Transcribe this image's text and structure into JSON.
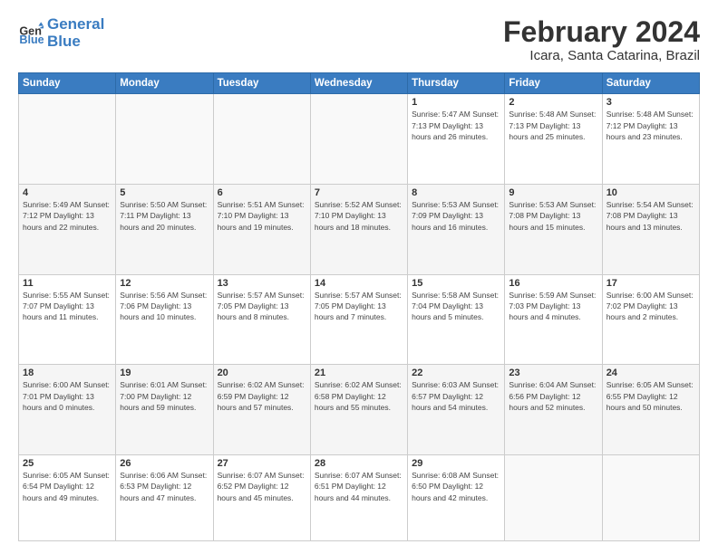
{
  "logo": {
    "line1": "General",
    "line2": "Blue"
  },
  "header": {
    "month_year": "February 2024",
    "location": "Icara, Santa Catarina, Brazil"
  },
  "days_of_week": [
    "Sunday",
    "Monday",
    "Tuesday",
    "Wednesday",
    "Thursday",
    "Friday",
    "Saturday"
  ],
  "weeks": [
    [
      {
        "day": "",
        "info": ""
      },
      {
        "day": "",
        "info": ""
      },
      {
        "day": "",
        "info": ""
      },
      {
        "day": "",
        "info": ""
      },
      {
        "day": "1",
        "info": "Sunrise: 5:47 AM\nSunset: 7:13 PM\nDaylight: 13 hours\nand 26 minutes."
      },
      {
        "day": "2",
        "info": "Sunrise: 5:48 AM\nSunset: 7:13 PM\nDaylight: 13 hours\nand 25 minutes."
      },
      {
        "day": "3",
        "info": "Sunrise: 5:48 AM\nSunset: 7:12 PM\nDaylight: 13 hours\nand 23 minutes."
      }
    ],
    [
      {
        "day": "4",
        "info": "Sunrise: 5:49 AM\nSunset: 7:12 PM\nDaylight: 13 hours\nand 22 minutes."
      },
      {
        "day": "5",
        "info": "Sunrise: 5:50 AM\nSunset: 7:11 PM\nDaylight: 13 hours\nand 20 minutes."
      },
      {
        "day": "6",
        "info": "Sunrise: 5:51 AM\nSunset: 7:10 PM\nDaylight: 13 hours\nand 19 minutes."
      },
      {
        "day": "7",
        "info": "Sunrise: 5:52 AM\nSunset: 7:10 PM\nDaylight: 13 hours\nand 18 minutes."
      },
      {
        "day": "8",
        "info": "Sunrise: 5:53 AM\nSunset: 7:09 PM\nDaylight: 13 hours\nand 16 minutes."
      },
      {
        "day": "9",
        "info": "Sunrise: 5:53 AM\nSunset: 7:08 PM\nDaylight: 13 hours\nand 15 minutes."
      },
      {
        "day": "10",
        "info": "Sunrise: 5:54 AM\nSunset: 7:08 PM\nDaylight: 13 hours\nand 13 minutes."
      }
    ],
    [
      {
        "day": "11",
        "info": "Sunrise: 5:55 AM\nSunset: 7:07 PM\nDaylight: 13 hours\nand 11 minutes."
      },
      {
        "day": "12",
        "info": "Sunrise: 5:56 AM\nSunset: 7:06 PM\nDaylight: 13 hours\nand 10 minutes."
      },
      {
        "day": "13",
        "info": "Sunrise: 5:57 AM\nSunset: 7:05 PM\nDaylight: 13 hours\nand 8 minutes."
      },
      {
        "day": "14",
        "info": "Sunrise: 5:57 AM\nSunset: 7:05 PM\nDaylight: 13 hours\nand 7 minutes."
      },
      {
        "day": "15",
        "info": "Sunrise: 5:58 AM\nSunset: 7:04 PM\nDaylight: 13 hours\nand 5 minutes."
      },
      {
        "day": "16",
        "info": "Sunrise: 5:59 AM\nSunset: 7:03 PM\nDaylight: 13 hours\nand 4 minutes."
      },
      {
        "day": "17",
        "info": "Sunrise: 6:00 AM\nSunset: 7:02 PM\nDaylight: 13 hours\nand 2 minutes."
      }
    ],
    [
      {
        "day": "18",
        "info": "Sunrise: 6:00 AM\nSunset: 7:01 PM\nDaylight: 13 hours\nand 0 minutes."
      },
      {
        "day": "19",
        "info": "Sunrise: 6:01 AM\nSunset: 7:00 PM\nDaylight: 12 hours\nand 59 minutes."
      },
      {
        "day": "20",
        "info": "Sunrise: 6:02 AM\nSunset: 6:59 PM\nDaylight: 12 hours\nand 57 minutes."
      },
      {
        "day": "21",
        "info": "Sunrise: 6:02 AM\nSunset: 6:58 PM\nDaylight: 12 hours\nand 55 minutes."
      },
      {
        "day": "22",
        "info": "Sunrise: 6:03 AM\nSunset: 6:57 PM\nDaylight: 12 hours\nand 54 minutes."
      },
      {
        "day": "23",
        "info": "Sunrise: 6:04 AM\nSunset: 6:56 PM\nDaylight: 12 hours\nand 52 minutes."
      },
      {
        "day": "24",
        "info": "Sunrise: 6:05 AM\nSunset: 6:55 PM\nDaylight: 12 hours\nand 50 minutes."
      }
    ],
    [
      {
        "day": "25",
        "info": "Sunrise: 6:05 AM\nSunset: 6:54 PM\nDaylight: 12 hours\nand 49 minutes."
      },
      {
        "day": "26",
        "info": "Sunrise: 6:06 AM\nSunset: 6:53 PM\nDaylight: 12 hours\nand 47 minutes."
      },
      {
        "day": "27",
        "info": "Sunrise: 6:07 AM\nSunset: 6:52 PM\nDaylight: 12 hours\nand 45 minutes."
      },
      {
        "day": "28",
        "info": "Sunrise: 6:07 AM\nSunset: 6:51 PM\nDaylight: 12 hours\nand 44 minutes."
      },
      {
        "day": "29",
        "info": "Sunrise: 6:08 AM\nSunset: 6:50 PM\nDaylight: 12 hours\nand 42 minutes."
      },
      {
        "day": "",
        "info": ""
      },
      {
        "day": "",
        "info": ""
      }
    ]
  ]
}
